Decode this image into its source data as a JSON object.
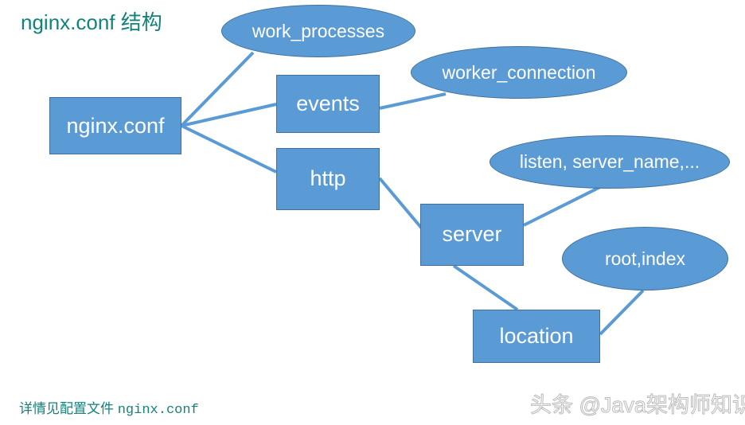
{
  "title": "nginx.conf 结构",
  "colors": {
    "node_fill": "#5B9BD5",
    "node_border": "#41719C",
    "edge": "#5B9BD5",
    "title_text": "#12837B",
    "footer_text": "#12837B",
    "node_text": "#FFFFFF",
    "background": "#FFFFFF"
  },
  "nodes": {
    "nginx_conf": {
      "label": "nginx.conf",
      "shape": "rectangle"
    },
    "events": {
      "label": "events",
      "shape": "rectangle"
    },
    "http": {
      "label": "http",
      "shape": "rectangle"
    },
    "server": {
      "label": "server",
      "shape": "rectangle"
    },
    "location": {
      "label": "location",
      "shape": "rectangle"
    },
    "work_processes": {
      "label": "work_processes",
      "shape": "ellipse"
    },
    "worker_connection": {
      "label": "worker_connection",
      "shape": "ellipse"
    },
    "listen_server_name": {
      "label": "listen, server_name,...",
      "shape": "ellipse"
    },
    "root_index": {
      "label": "root,index",
      "shape": "ellipse"
    }
  },
  "edges": [
    {
      "from": "nginx_conf",
      "to": "work_processes"
    },
    {
      "from": "nginx_conf",
      "to": "events"
    },
    {
      "from": "nginx_conf",
      "to": "http"
    },
    {
      "from": "events",
      "to": "worker_connection"
    },
    {
      "from": "http",
      "to": "server"
    },
    {
      "from": "server",
      "to": "listen_server_name"
    },
    {
      "from": "server",
      "to": "location"
    },
    {
      "from": "location",
      "to": "root_index"
    }
  ],
  "footer": {
    "note_prefix": "详情见配置文件 ",
    "note_file": "nginx.conf",
    "watermark": "头条 @Java架构师知识"
  }
}
